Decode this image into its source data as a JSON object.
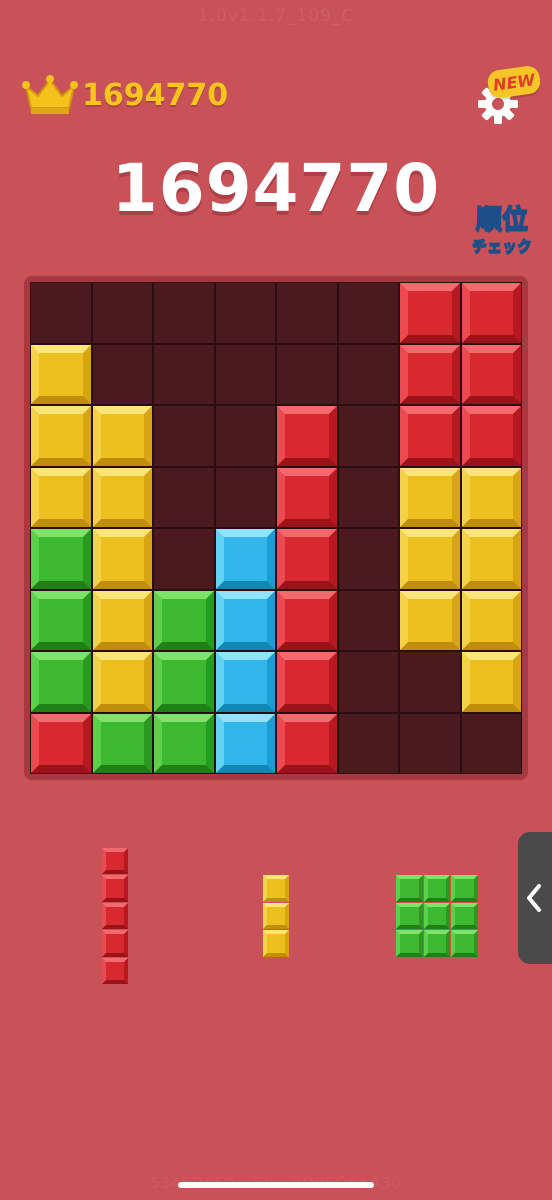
{
  "header": {
    "best_score": "1694770",
    "new_badge": "NEW",
    "version": "1.0v1.1.7_109_C"
  },
  "score": {
    "current": "1694770"
  },
  "ranking_button": {
    "line1": "順位",
    "line2": "チェック"
  },
  "footer": {
    "id_text": "5345D5F0 - 50...0D96C6AA30"
  },
  "icons": [
    "crown-icon",
    "gear-icon",
    "chevron-left-icon"
  ],
  "colors": {
    "background": "#c85258",
    "board_empty": "#4a1a1e",
    "red": "#d92930",
    "yellow": "#ecc11f",
    "green": "#3cb831",
    "blue": "#33b7ea",
    "best_score": "#f7c51e"
  },
  "board": {
    "rows": 8,
    "cols": 8,
    "cells": [
      [
        ".",
        ".",
        ".",
        ".",
        ".",
        ".",
        "R",
        "R"
      ],
      [
        "Y",
        ".",
        ".",
        ".",
        ".",
        ".",
        "R",
        "R"
      ],
      [
        "Y",
        "Y",
        ".",
        ".",
        "R",
        ".",
        "R",
        "R"
      ],
      [
        "Y",
        "Y",
        ".",
        ".",
        "R",
        ".",
        "Y",
        "Y"
      ],
      [
        "G",
        "Y",
        ".",
        "B",
        "R",
        ".",
        "Y",
        "Y"
      ],
      [
        "G",
        "Y",
        "G",
        "B",
        "R",
        ".",
        "Y",
        "Y"
      ],
      [
        "G",
        "Y",
        "G",
        "B",
        "R",
        ".",
        ".",
        "Y"
      ],
      [
        "R",
        "G",
        "G",
        "B",
        "R",
        ".",
        ".",
        "."
      ]
    ]
  },
  "pieces": [
    {
      "color": "R",
      "rows": 5,
      "cols": 1
    },
    {
      "color": "Y",
      "rows": 3,
      "cols": 1
    },
    {
      "color": "G",
      "rows": 3,
      "cols": 3
    }
  ]
}
